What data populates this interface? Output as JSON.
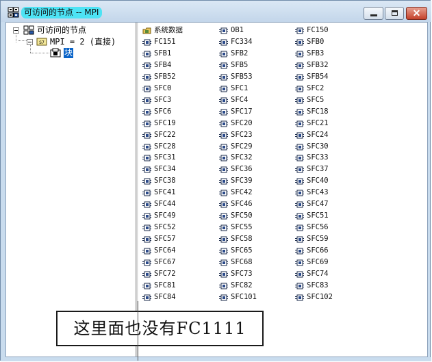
{
  "window": {
    "title": "可访问的节点 -- MPI",
    "icons": {
      "app": "network-nodes-icon",
      "minimize": "minimize-icon",
      "maximize": "maximize-icon",
      "close": "close-icon"
    },
    "close_glyph": "✕"
  },
  "tree": {
    "root_label": "可访问的节点",
    "station_label": "MPI =   2 (直接)",
    "blocks_label": "块",
    "icons": {
      "root": "network-icon",
      "station": "s7-station-icon",
      "blocks": "blocks-folder-icon"
    }
  },
  "list": {
    "items": [
      "系统数据",
      "FC151",
      "SFB1",
      "SFB4",
      "SFB52",
      "SFC0",
      "SFC3",
      "SFC6",
      "SFC19",
      "SFC22",
      "SFC28",
      "SFC31",
      "SFC34",
      "SFC38",
      "SFC41",
      "SFC44",
      "SFC49",
      "SFC52",
      "SFC57",
      "SFC64",
      "SFC67",
      "SFC72",
      "SFC81",
      "SFC84",
      "OB1",
      "FC334",
      "SFB2",
      "SFB5",
      "SFB53",
      "SFC1",
      "SFC4",
      "SFC17",
      "SFC20",
      "SFC23",
      "SFC29",
      "SFC32",
      "SFC36",
      "SFC39",
      "SFC42",
      "SFC46",
      "SFC50",
      "SFC55",
      "SFC58",
      "SFC65",
      "SFC68",
      "SFC73",
      "SFC82",
      "SFC101",
      "FC150",
      "SFB0",
      "SFB3",
      "SFB32",
      "SFB54",
      "SFC2",
      "SFC5",
      "SFC18",
      "SFC21",
      "SFC24",
      "SFC30",
      "SFC33",
      "SFC37",
      "SFC40",
      "SFC43",
      "SFC47",
      "SFC51",
      "SFC56",
      "SFC59",
      "SFC66",
      "SFC69",
      "SFC74",
      "SFC83",
      "SFC102"
    ],
    "icons": {
      "system_data": "system-data-folder-icon",
      "block": "block-icon"
    }
  },
  "annotation": {
    "text": "这里面也没有FC1111"
  },
  "colors": {
    "title_highlight": "#4de3f4",
    "selection": "#0a64c8",
    "frame": "#c9dcee"
  }
}
